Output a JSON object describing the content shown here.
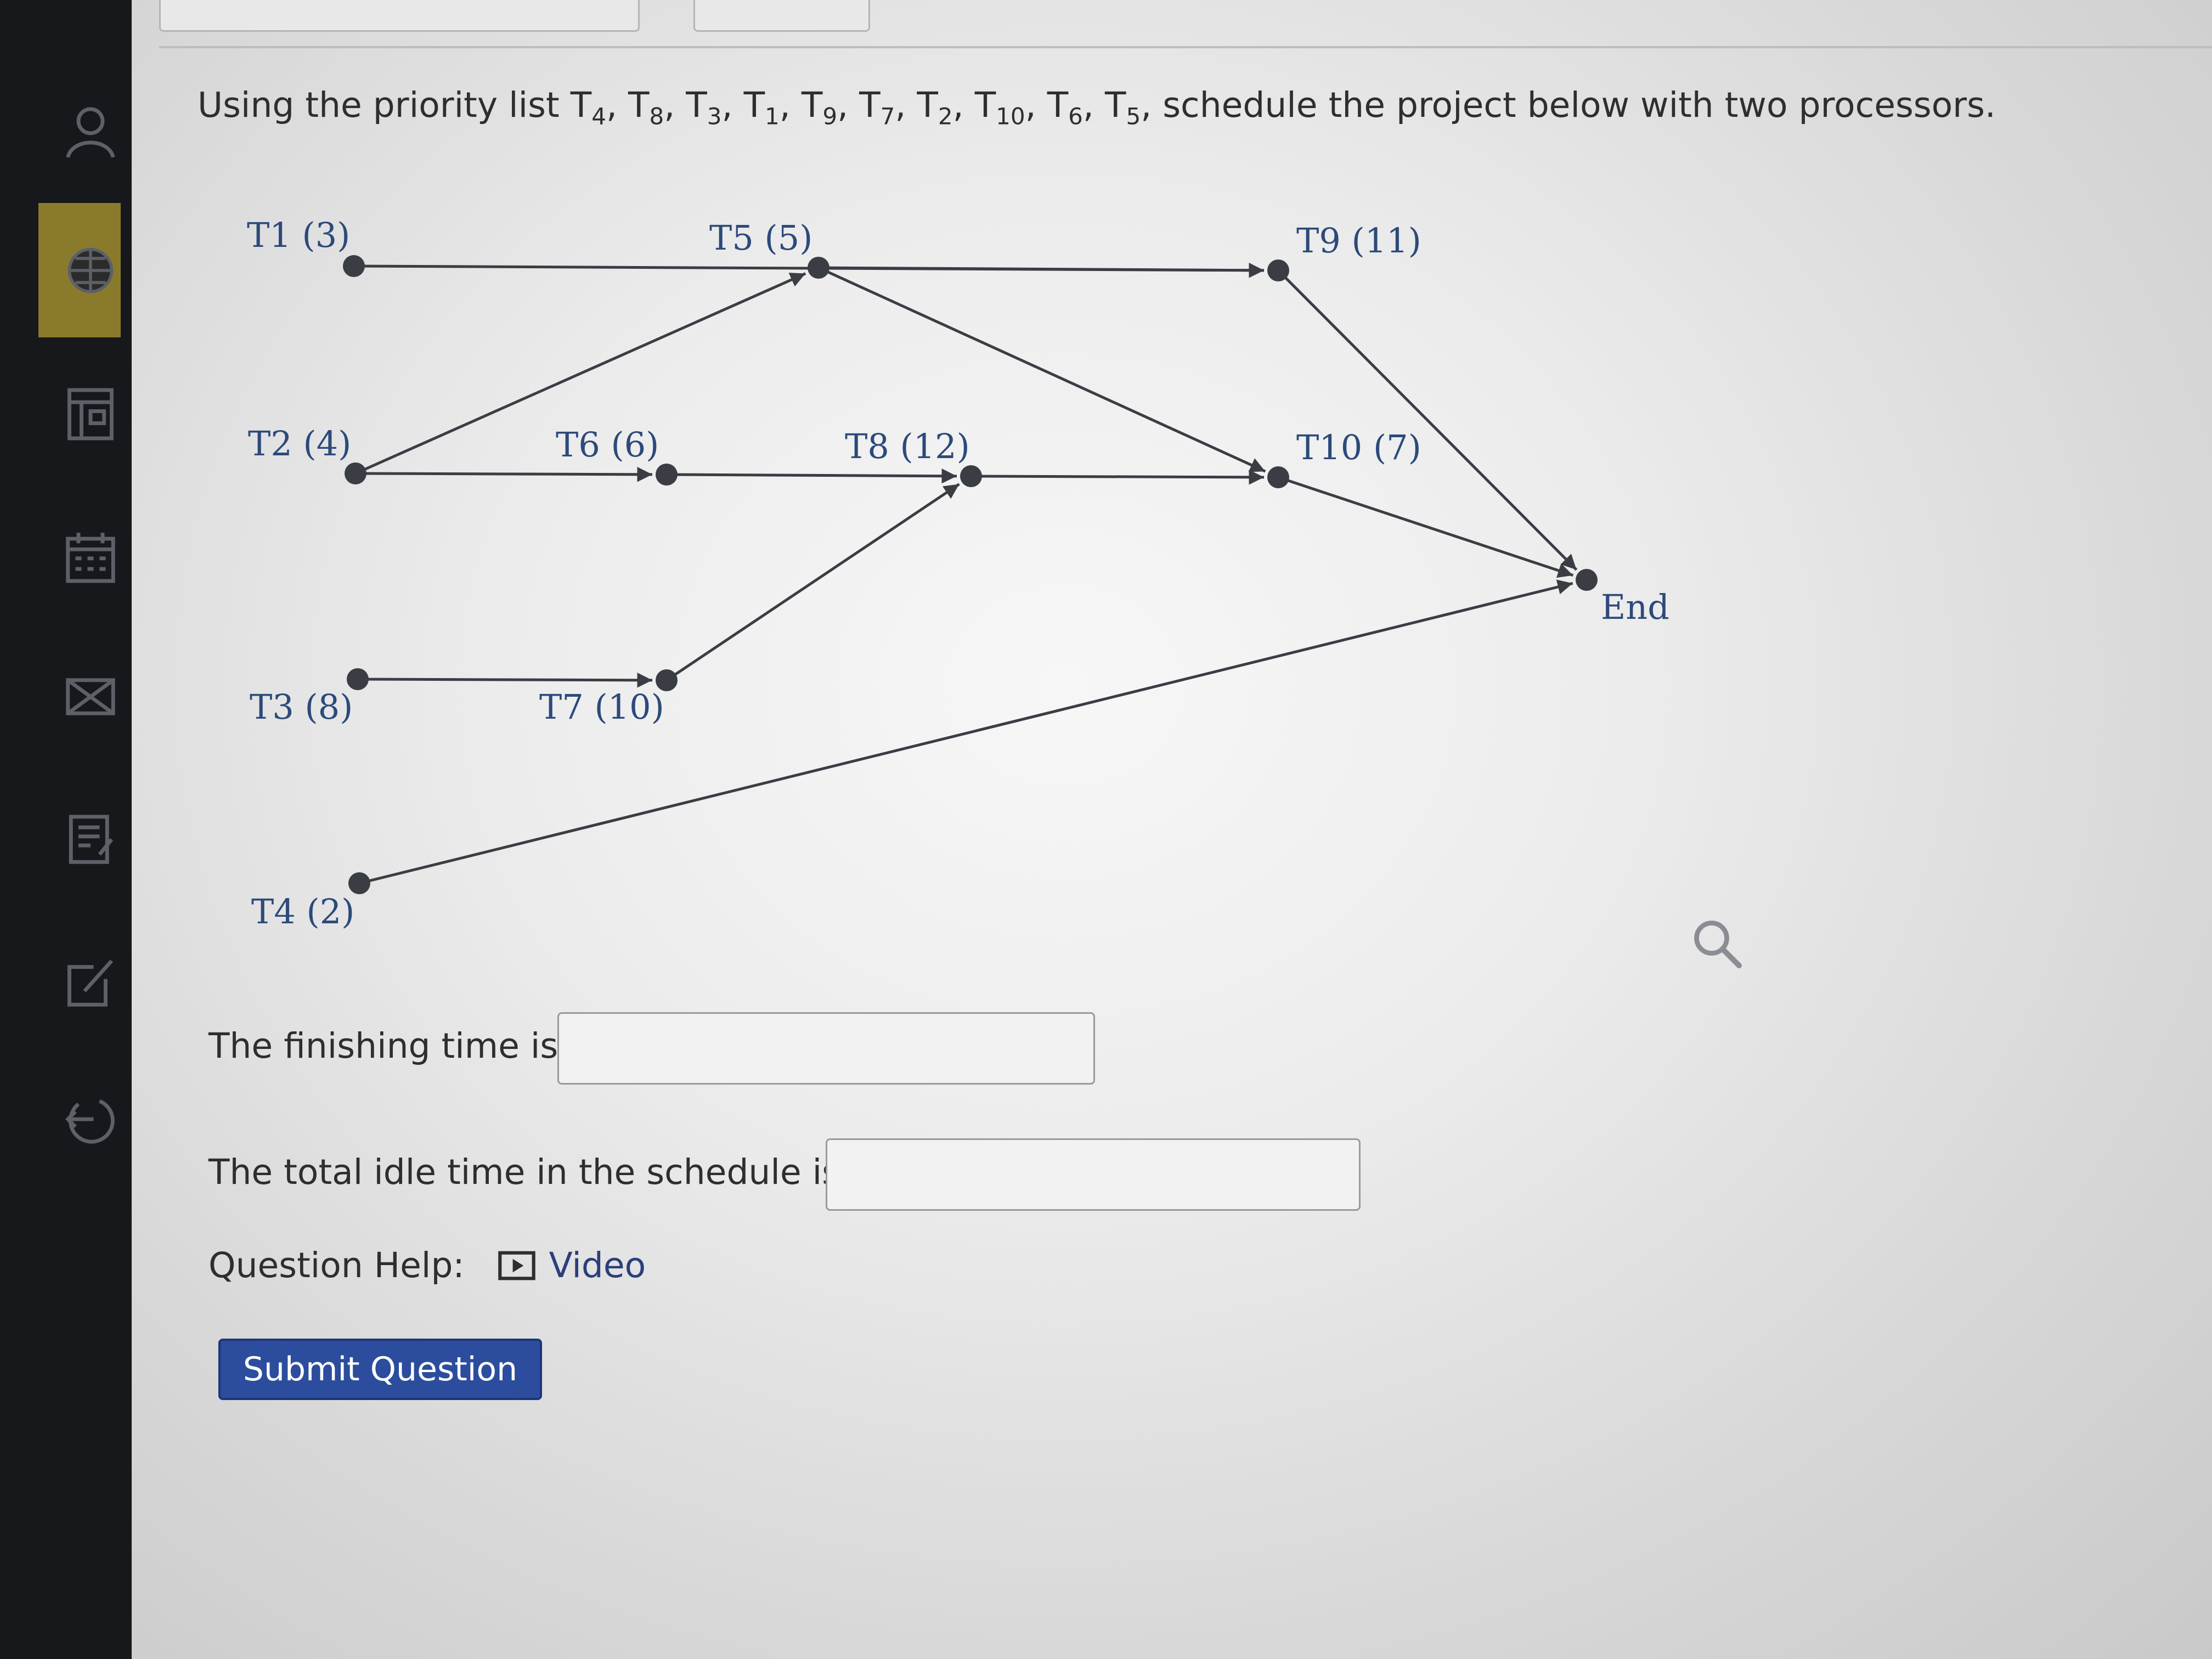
{
  "question": {
    "prefix": "Using the priority list ",
    "priority_list": [
      "4",
      "8",
      "3",
      "1",
      "9",
      "7",
      "2",
      "10",
      "6",
      "5"
    ],
    "suffix": ", schedule the project below with two processors."
  },
  "diagram": {
    "tasks": [
      {
        "id": "T1",
        "label": "T1 (3)"
      },
      {
        "id": "T2",
        "label": "T2 (4)"
      },
      {
        "id": "T3",
        "label": "T3 (8)"
      },
      {
        "id": "T4",
        "label": "T4 (2)"
      },
      {
        "id": "T5",
        "label": "T5 (5)"
      },
      {
        "id": "T6",
        "label": "T6 (6)"
      },
      {
        "id": "T7",
        "label": "T7 (10)"
      },
      {
        "id": "T8",
        "label": "T8 (12)"
      },
      {
        "id": "T9",
        "label": "T9 (11)"
      },
      {
        "id": "T10",
        "label": "T10 (7)"
      },
      {
        "id": "End",
        "label": "End"
      }
    ],
    "edges": [
      [
        "T1",
        "T9"
      ],
      [
        "T2",
        "T5"
      ],
      [
        "T2",
        "T6"
      ],
      [
        "T3",
        "T7"
      ],
      [
        "T4",
        "End"
      ],
      [
        "T5",
        "T9"
      ],
      [
        "T5",
        "T10"
      ],
      [
        "T6",
        "T8"
      ],
      [
        "T7",
        "T8"
      ],
      [
        "T8",
        "T10"
      ],
      [
        "T9",
        "End"
      ],
      [
        "T10",
        "End"
      ]
    ]
  },
  "answers": {
    "finishing_label": "The finishing time is:",
    "finishing_value": "",
    "idle_label": "The total idle time in the schedule is:",
    "idle_value": ""
  },
  "help": {
    "label": "Question Help:",
    "video_label": "Video"
  },
  "submit_label": "Submit Question",
  "sidebar_icons": [
    "user-icon",
    "globe-icon",
    "gradebook-icon",
    "calendar-icon",
    "mail-icon",
    "notes-icon",
    "edit-icon",
    "logout-icon"
  ],
  "colors": {
    "link": "#2c4a7a",
    "button": "#2c4d9e",
    "sidebar": "#17181b",
    "sidebar_active": "#8a7a2c",
    "graph": "#3a3d44"
  }
}
